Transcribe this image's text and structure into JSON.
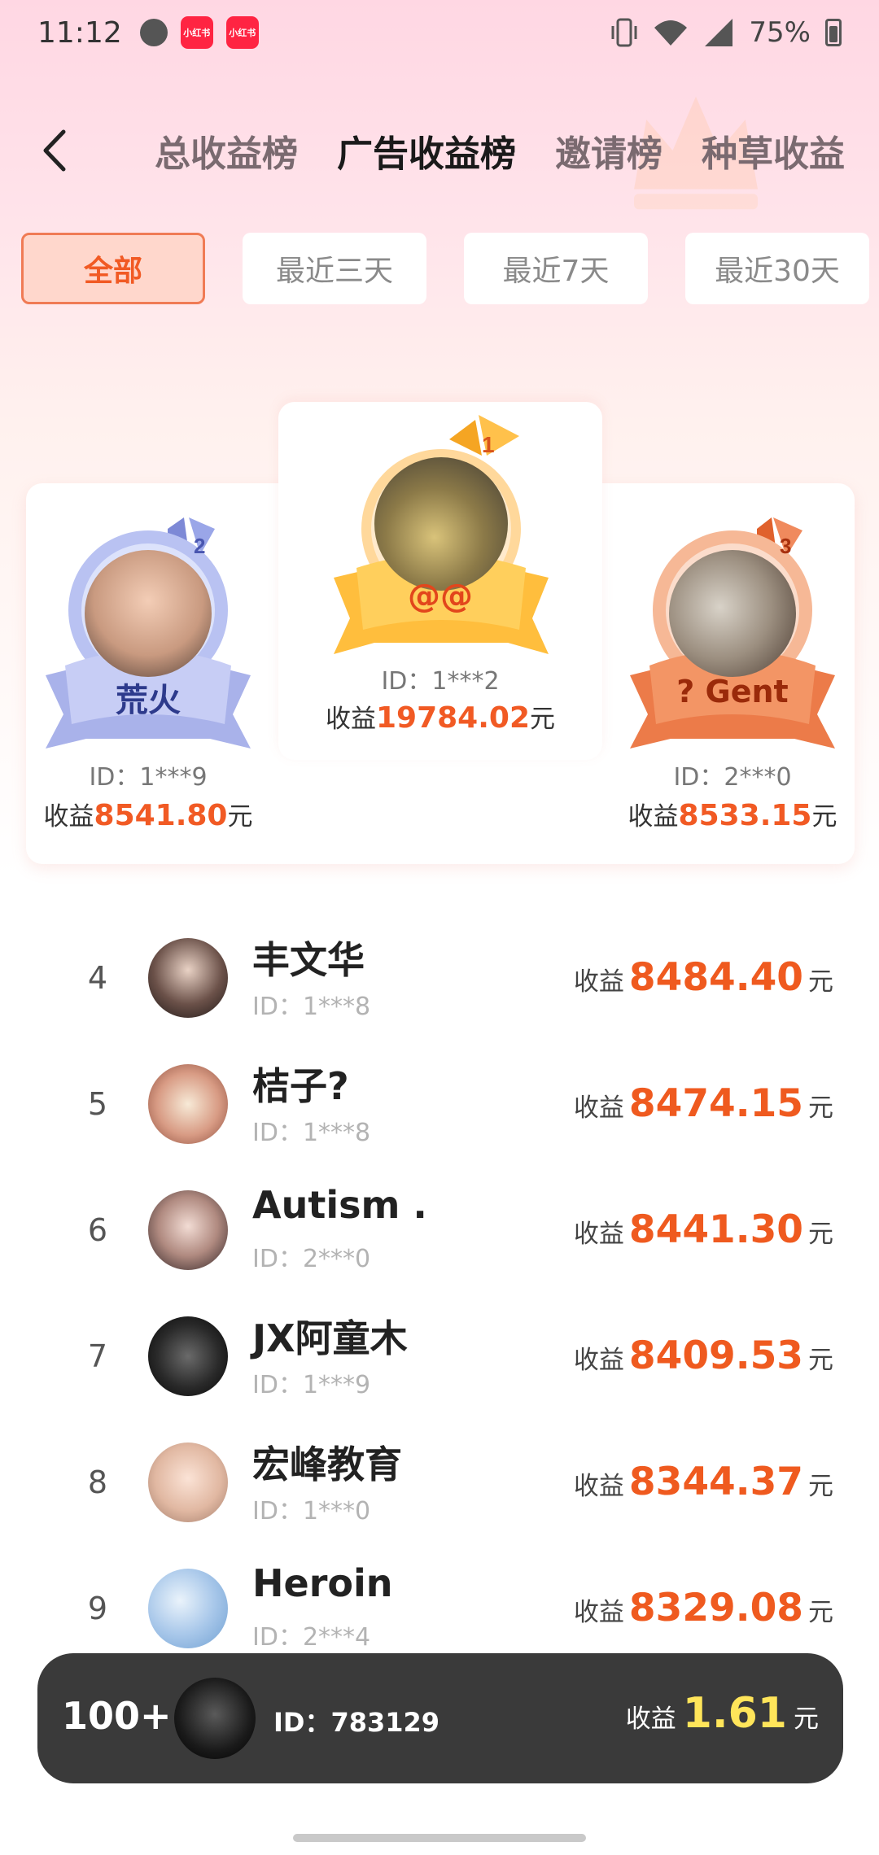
{
  "status_bar": {
    "time": "11:12",
    "app_badge_1": "小红书",
    "app_badge_2": "小红书",
    "battery": "75%"
  },
  "header": {
    "tabs": [
      {
        "label": "总收益榜"
      },
      {
        "label": "广告收益榜"
      },
      {
        "label": "邀请榜"
      },
      {
        "label": "种草收益"
      }
    ],
    "active_tab_index": 1
  },
  "filters": [
    {
      "label": "全部"
    },
    {
      "label": "最近三天"
    },
    {
      "label": "最近7天"
    },
    {
      "label": "最近30天"
    }
  ],
  "earn_prefix": "收益",
  "currency_suffix": "元",
  "podium": {
    "first": {
      "rank": "1",
      "name": "@@",
      "id": "ID：1***2",
      "amount": "19784.02",
      "color": "#ffb542"
    },
    "second": {
      "rank": "2",
      "name": "荒火",
      "id": "ID：1***9",
      "amount": "8541.80",
      "color": "#9aa6e8"
    },
    "third": {
      "rank": "3",
      "name": "? Gent",
      "id": "ID：2***0",
      "amount": "8533.15",
      "color": "#f08a5d"
    }
  },
  "list": [
    {
      "rank": "4",
      "name": "丰文华",
      "id": "ID：1***8",
      "amount": "8484.40"
    },
    {
      "rank": "5",
      "name": "桔子?",
      "id": "ID：1***8",
      "amount": "8474.15"
    },
    {
      "rank": "6",
      "name": "Autism .",
      "id": "ID：2***0",
      "amount": "8441.30"
    },
    {
      "rank": "7",
      "name": "JX阿童木",
      "id": "ID：1***9",
      "amount": "8409.53"
    },
    {
      "rank": "8",
      "name": "宏峰教育",
      "id": "ID：1***0",
      "amount": "8344.37"
    },
    {
      "rank": "9",
      "name": "Heroin",
      "id": "ID：2***4",
      "amount": "8329.08"
    }
  ],
  "my_rank": {
    "rank": "100+",
    "id": "ID：783129",
    "amount": "1.61"
  },
  "colors": {
    "accent": "#f15a24",
    "highlight_yellow": "#ffe55a"
  }
}
